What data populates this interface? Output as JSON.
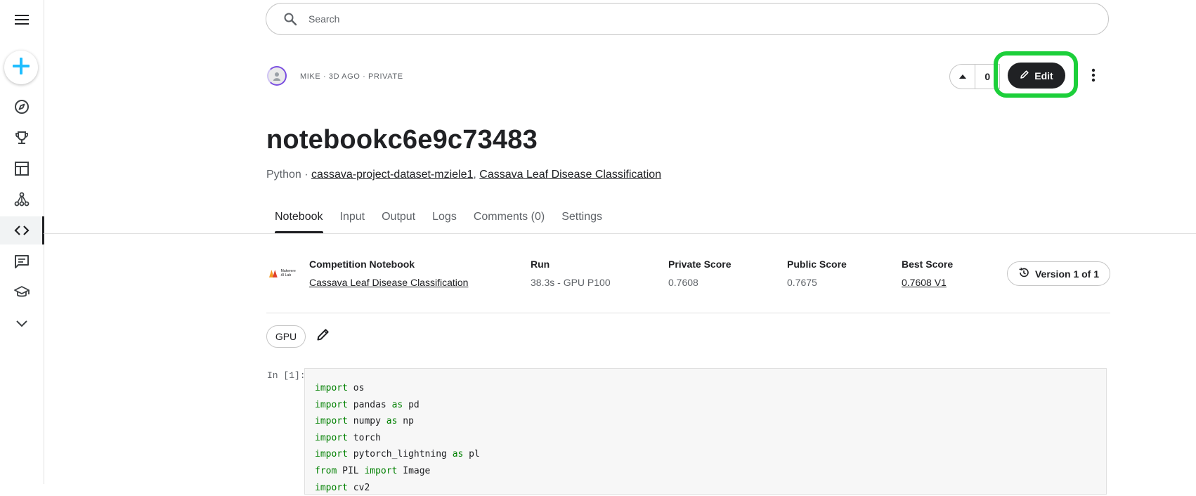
{
  "sidebar": {
    "items": [
      {
        "name": "menu-icon"
      },
      {
        "name": "create-icon"
      },
      {
        "name": "compass-icon"
      },
      {
        "name": "trophy-icon"
      },
      {
        "name": "table-icon"
      },
      {
        "name": "models-icon"
      },
      {
        "name": "code-icon",
        "active": true
      },
      {
        "name": "comments-icon"
      },
      {
        "name": "learn-icon"
      },
      {
        "name": "chevron-down-icon"
      }
    ]
  },
  "search": {
    "placeholder": "Search"
  },
  "header": {
    "meta": "MIKE · 3D AGO · PRIVATE",
    "vote_count": "0",
    "edit_label": "Edit"
  },
  "notebook": {
    "title": "notebookc6e9c73483",
    "language": "Python ·",
    "dataset_1": "cassava-project-dataset-mziele1",
    "separator": ",",
    "dataset_2": "Cassava Leaf Disease Classification"
  },
  "tabs": [
    {
      "label": "Notebook",
      "active": true
    },
    {
      "label": "Input"
    },
    {
      "label": "Output"
    },
    {
      "label": "Logs"
    },
    {
      "label": "Comments (0)"
    },
    {
      "label": "Settings"
    }
  ],
  "info": {
    "competition_label": "Competition Notebook",
    "competition_value": "Cassava Leaf Disease Classification",
    "run_label": "Run",
    "run_value": "38.3s - GPU P100",
    "private_label": "Private Score",
    "private_value": "0.7608",
    "public_label": "Public Score",
    "public_value": "0.7675",
    "best_label": "Best Score",
    "best_value": "0.7608 V1",
    "version_label": "Version 1 of 1",
    "logo_text": "Makerere AI Lab"
  },
  "accelerator": {
    "label": "GPU"
  },
  "cell": {
    "prompt": "In [1]:",
    "lines": [
      [
        {
          "t": "import",
          "k": true
        },
        {
          "t": " os"
        }
      ],
      [
        {
          "t": "import",
          "k": true
        },
        {
          "t": " pandas "
        },
        {
          "t": "as",
          "k": true
        },
        {
          "t": " pd"
        }
      ],
      [
        {
          "t": "import",
          "k": true
        },
        {
          "t": " numpy "
        },
        {
          "t": "as",
          "k": true
        },
        {
          "t": " np"
        }
      ],
      [
        {
          "t": "import",
          "k": true
        },
        {
          "t": " torch"
        }
      ],
      [
        {
          "t": "import",
          "k": true
        },
        {
          "t": " pytorch_lightning "
        },
        {
          "t": "as",
          "k": true
        },
        {
          "t": " pl"
        }
      ],
      [
        {
          "t": "from",
          "k": true
        },
        {
          "t": " PIL "
        },
        {
          "t": "import",
          "k": true
        },
        {
          "t": " Image"
        }
      ],
      [
        {
          "t": "import",
          "k": true
        },
        {
          "t": " cv2"
        }
      ]
    ]
  },
  "colors": {
    "accent_create": "#20beff",
    "highlight": "#1ccf3a",
    "keyword": "#008000",
    "edit_bg": "#202124"
  }
}
